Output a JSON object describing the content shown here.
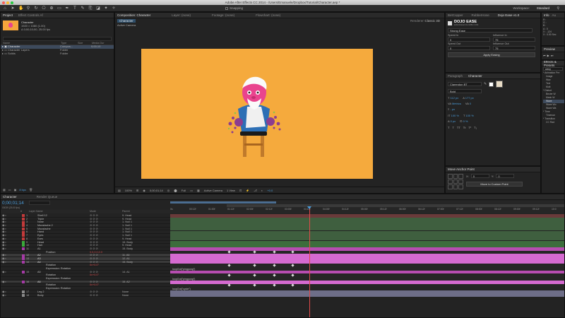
{
  "window_title": "Adobe After Effects CC 2014 - /Users/Emanuele/Dropbox/Tutorial/Character.aep *",
  "toolbar": {
    "snapping": "Snapping",
    "workspace_label": "Workspace:",
    "workspace_value": "Standard"
  },
  "project": {
    "tab": "Project",
    "tab2": "Effect Controls Af",
    "item_name": "Character",
    "item_info": [
      "1920 × 1080 (1.00)",
      "Δ 0;00;10;00, 25.00 fps"
    ],
    "columns": [
      "Name",
      "Type",
      "Size",
      "Media Dur"
    ],
    "rows": [
      {
        "name": "Character",
        "type": "Compos...",
        "dur": "0;00;10"
      },
      {
        "name": "Character Layers",
        "type": "Folder",
        "dur": ""
      },
      {
        "name": "Solids",
        "type": "Folder",
        "dur": ""
      }
    ],
    "bpc": "8 bpc"
  },
  "viewer": {
    "tabs": [
      "Composition: Character",
      "Layer: (none)",
      "Footage: (none)",
      "Flowchart: (none)"
    ],
    "comp_tab": "Character",
    "camera": "Active Camera",
    "renderer_label": "Renderer:",
    "renderer_value": "Classic 3D",
    "zoom": "100%",
    "timecode": "0;00;01;14",
    "resolution": "Full",
    "camera_select": "Active Camera",
    "view_select": "1 View",
    "exposure": "+0.0"
  },
  "dojo": {
    "tabs": [
      "BetCopper",
      "RubberHose",
      "Dojo Ease v1.0"
    ],
    "title": "DOJO EASE",
    "subtitle": "EMANUELECOLOMBO.COM",
    "preset": "Strong Ease",
    "speed_in_label": "Speed In",
    "influence_in_label": "Influence In",
    "speed_in": "0",
    "influence_in": "75",
    "speed_out_label": "Speed Out",
    "influence_out_label": "Influence Out",
    "speed_out": "0",
    "influence_out": "75",
    "apply": "Apply Easing"
  },
  "character_panel": {
    "tabs": [
      "Paragraph",
      "Character"
    ],
    "font": "Clarendon BT",
    "style": "Bold",
    "size": "112 px",
    "leading": "177 px",
    "kerning": "Metrics",
    "tracking": "0",
    "stroke": "- px",
    "vscale": "100 %",
    "hscale": "100 %",
    "baseline": "0 px",
    "tsume": "0 %"
  },
  "anchor_panel": {
    "title": "Move Anchor Point",
    "x_label": "X:",
    "x": "0",
    "y_label": "Y:",
    "y": "0",
    "button": "Move to Custom Point"
  },
  "info_panel": {
    "tabs": [
      "Info",
      "Au"
    ],
    "lines": [
      "R :",
      "G :",
      "B :",
      "A : 0",
      "X : -124",
      "Y : 1140"
    ],
    "x_val": "X : 0.00 Sec"
  },
  "preview_panel": {
    "tab": "Preview"
  },
  "effects_panel": {
    "tab": "Effects & Presets",
    "search": "wavy",
    "items": [
      "* Animation Pre",
      "Image",
      "Wav",
      "Text",
      "Mult",
      "* Distort",
      "Bezier W",
      "Mesh W",
      "Wave",
      "Wave Wo",
      "Wave Wa",
      "* Time",
      "Timewar",
      "* Transition",
      "CC Rad"
    ]
  },
  "timeline": {
    "tabs": [
      "Character",
      "Render Queue"
    ],
    "timecode": "0;00;01;14",
    "frame_info": "00039 (25.00 fps)",
    "header": [
      "#",
      "Layer Name",
      "Mode",
      "Parent"
    ],
    "ruler": [
      "0s",
      "00:12f",
      "01:00f",
      "01:12f",
      "02:00f",
      "02:12f",
      "03:00f",
      "03:12f",
      "04:00f",
      "04:12f",
      "05:00f",
      "05:12f",
      "06:00f",
      "06:12f",
      "07:00f",
      "07:12f",
      "08:00f",
      "08:12f",
      "09:00f",
      "09:12f",
      "10:0"
    ],
    "rows": [
      {
        "n": "1",
        "name": "Shell 12",
        "parent": "9. Head",
        "color": "#c23a3a"
      },
      {
        "n": "2",
        "name": "Triple",
        "parent": "9. Head",
        "color": "#c23a3a"
      },
      {
        "n": "3",
        "name": "Nose",
        "parent": "1. Null 1",
        "color": "#c23a3a"
      },
      {
        "n": "4",
        "name": "Moustache 2",
        "parent": "1. Null 1",
        "color": "#c23a3a"
      },
      {
        "n": "5",
        "name": "Moustache",
        "parent": "1. Null 1",
        "color": "#c23a3a"
      },
      {
        "n": "6",
        "name": "Hand",
        "parent": "1. Null 1",
        "color": "#c23a3a"
      },
      {
        "n": "7",
        "name": "Eyes",
        "parent": "1. Null 1",
        "color": "#c23a3a"
      },
      {
        "n": "8",
        "name": "Ears",
        "parent": "9. Head",
        "color": "#c23a3a"
      },
      {
        "n": "9",
        "name": "Head",
        "parent": "15. Body",
        "color": "#3aa83a"
      },
      {
        "n": "10",
        "name": "Hair",
        "parent": "9. Head",
        "color": "#3aa83a"
      },
      {
        "n": "11",
        "name": "A1",
        "parent": "15. Body",
        "color": "#a53aa5"
      },
      {
        "n": "",
        "name": "Position",
        "parent": "",
        "color": ""
      },
      {
        "n": "12",
        "name": "A2",
        "parent": "11. A6",
        "color": "#a53aa5"
      },
      {
        "n": "13",
        "name": "A3",
        "parent": "12. A1",
        "color": "#a53aa5"
      },
      {
        "n": "14",
        "name": "A4",
        "parent": "15. Body",
        "color": "#a53aa5"
      },
      {
        "n": "",
        "name": "Rotation",
        "parent": "",
        "color": ""
      },
      {
        "n": "",
        "name": "Expression: Rotation",
        "parent": "",
        "color": ""
      },
      {
        "n": "15",
        "name": "A5",
        "parent": "14. A1",
        "color": "#a53aa5"
      },
      {
        "n": "",
        "name": "Rotation",
        "parent": "",
        "color": ""
      },
      {
        "n": "",
        "name": "Expression: Rotation",
        "parent": "",
        "color": ""
      },
      {
        "n": "16",
        "name": "A6",
        "parent": "15. A2",
        "color": "#a53aa5"
      },
      {
        "n": "",
        "name": "Rotation",
        "parent": "",
        "color": ""
      },
      {
        "n": "",
        "name": "Expression: Rotation",
        "parent": "",
        "color": ""
      },
      {
        "n": "17",
        "name": "Leg 2",
        "parent": "None",
        "color": "#8a8a8a"
      },
      {
        "n": "18",
        "name": "Body",
        "parent": "None",
        "color": "#8a8a8a"
      }
    ],
    "value_pos": "0.0,0.0,0.0",
    "value_rot1": "0x+0.0°",
    "value_rot2": "0x+0.0°",
    "value_rot3": "0x+0.0°",
    "expr1": "loopOut(\"pingpong\")",
    "expr2": "loopOut(\"pingpong\")",
    "expr3": "loopOut(\"cycle\")"
  }
}
